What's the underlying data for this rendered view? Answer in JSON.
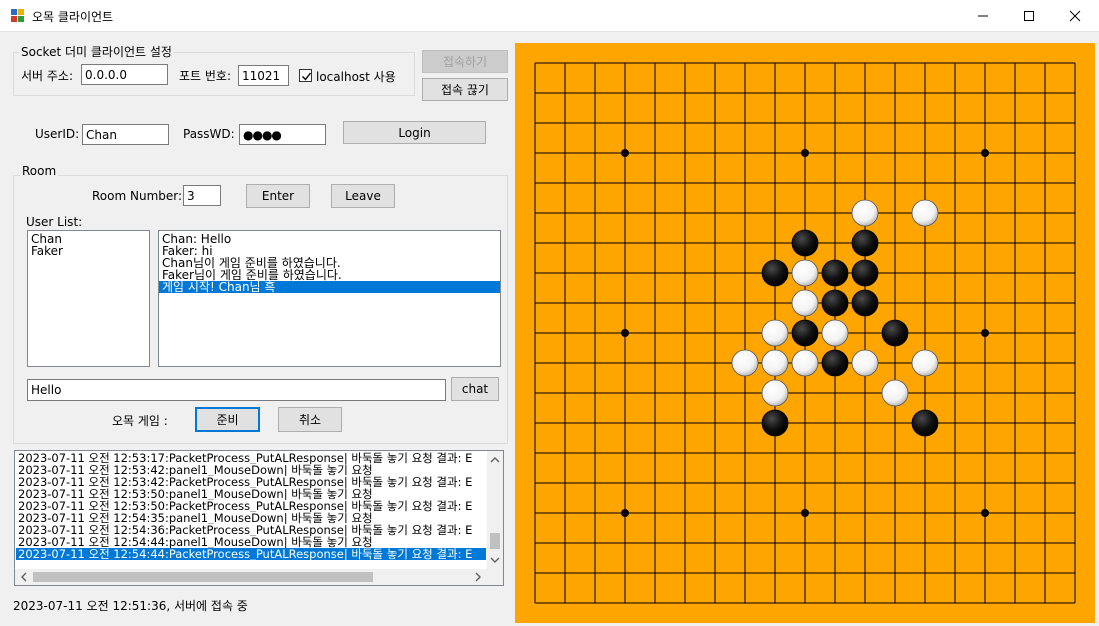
{
  "window": {
    "title": "오목 클라이언트",
    "icon": "app-icon",
    "controls": [
      "minimize-icon",
      "maximize-icon",
      "close-icon"
    ]
  },
  "connection": {
    "group_title": "Socket 더미 클라이언트 설정",
    "server_label": "서버 주소:",
    "server_value": "0.0.0.0",
    "port_label": "포트 번호:",
    "port_value": "11021",
    "localhost_label": "localhost 사용",
    "localhost_checked": true,
    "connect_label": "접속하기",
    "disconnect_label": "접속 끊기"
  },
  "login": {
    "userid_label": "UserID:",
    "userid_value": "Chan",
    "passwd_label": "PassWD:",
    "passwd_value": "●●●●",
    "login_label": "Login"
  },
  "room": {
    "group_title": "Room",
    "number_label": "Room Number:",
    "number_value": "3",
    "enter_label": "Enter",
    "leave_label": "Leave",
    "userlist_label": "User List:",
    "users": [
      "Chan",
      "Faker"
    ],
    "chat_messages": [
      "Chan: Hello",
      "Faker: hi",
      "Chan님이 게임 준비를 하였습니다.",
      "Faker님이 게임 준비를 하였습니다.",
      "게임 시작! Chan님 흑"
    ],
    "selected_chat_index": 4,
    "chat_input_value": "Hello",
    "chat_button_label": "chat",
    "game_label": "오목 게임 :",
    "ready_label": "준비",
    "cancel_label": "취소"
  },
  "log": {
    "lines": [
      "2023-07-11 오전 12:53:17:PacketProcess_PutALResponse| 바둑돌 놓기 요청 결과:  E",
      "2023-07-11 오전 12:53:42:panel1_MouseDown| 바둑돌 놓기 요청",
      "2023-07-11 오전 12:53:42:PacketProcess_PutALResponse| 바둑돌 놓기 요청 결과:  E",
      "2023-07-11 오전 12:53:50:panel1_MouseDown| 바둑돌 놓기 요청",
      "2023-07-11 오전 12:53:50:PacketProcess_PutALResponse| 바둑돌 놓기 요청 결과:  E",
      "2023-07-11 오전 12:54:35:panel1_MouseDown| 바둑돌 놓기 요청",
      "2023-07-11 오전 12:54:36:PacketProcess_PutALResponse| 바둑돌 놓기 요청 결과:  E",
      "2023-07-11 오전 12:54:44:panel1_MouseDown| 바둑돌 놓기 요청",
      "2023-07-11 오전 12:54:44:PacketProcess_PutALResponse| 바둑돌 놓기 요청 결과:  E"
    ],
    "selected_index": 8
  },
  "status": {
    "text": "2023-07-11 오전 12:51:36, 서버에 접속 중"
  },
  "board": {
    "size": 19,
    "star_points": [
      [
        3,
        3
      ],
      [
        3,
        9
      ],
      [
        3,
        15
      ],
      [
        9,
        3
      ],
      [
        9,
        9
      ],
      [
        9,
        15
      ],
      [
        15,
        3
      ],
      [
        15,
        9
      ],
      [
        15,
        15
      ]
    ],
    "black_stones": [
      [
        6,
        9
      ],
      [
        6,
        11
      ],
      [
        7,
        8
      ],
      [
        7,
        10
      ],
      [
        7,
        11
      ],
      [
        8,
        10
      ],
      [
        8,
        11
      ],
      [
        9,
        9
      ],
      [
        9,
        12
      ],
      [
        10,
        10
      ],
      [
        12,
        8
      ],
      [
        12,
        13
      ]
    ],
    "white_stones": [
      [
        5,
        11
      ],
      [
        5,
        13
      ],
      [
        7,
        9
      ],
      [
        8,
        9
      ],
      [
        9,
        8
      ],
      [
        9,
        10
      ],
      [
        10,
        7
      ],
      [
        10,
        8
      ],
      [
        10,
        9
      ],
      [
        10,
        11
      ],
      [
        10,
        13
      ],
      [
        11,
        8
      ],
      [
        11,
        12
      ]
    ],
    "colors": {
      "board": "#ffa500",
      "line": "#000000",
      "black": "#000000",
      "white": "#ffffff"
    }
  }
}
